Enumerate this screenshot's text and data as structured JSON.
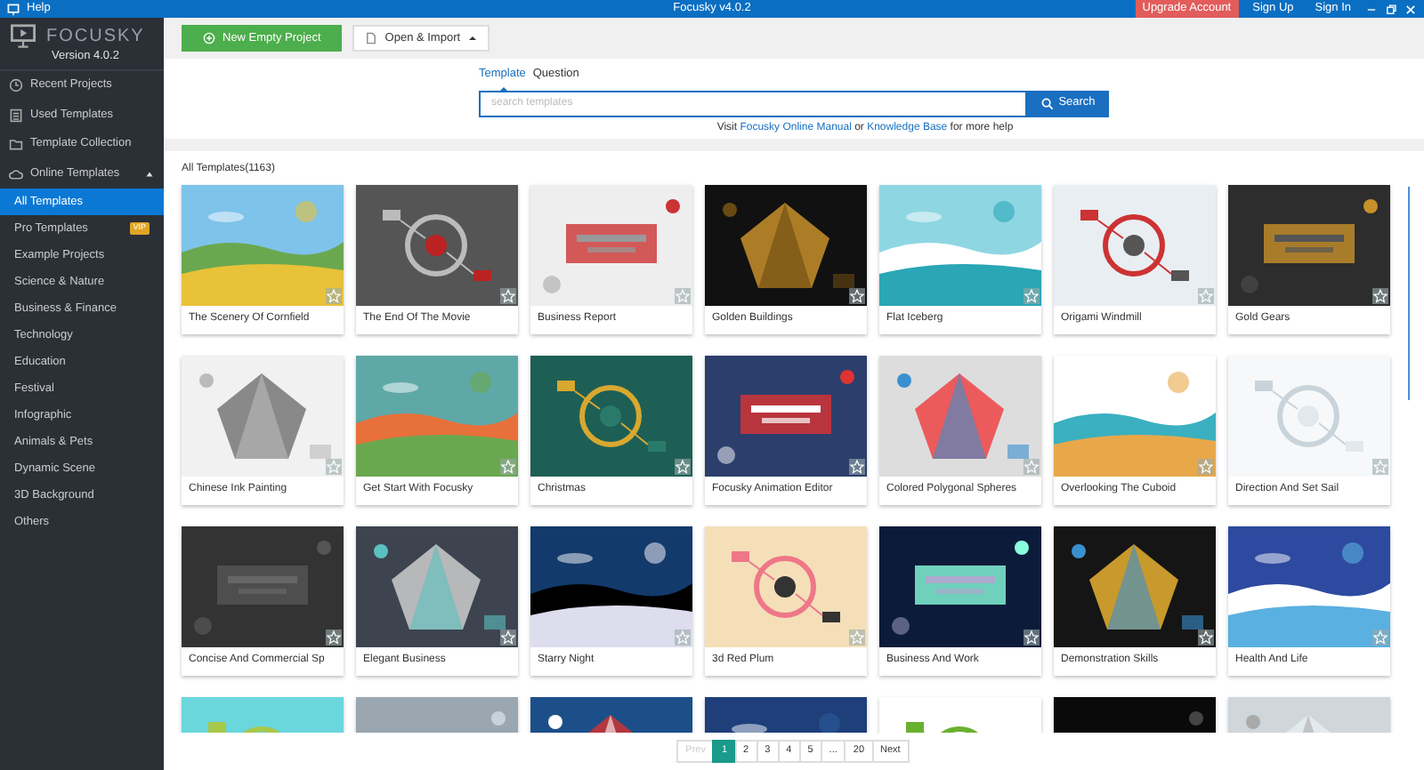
{
  "title_bar": {
    "menu": "Help",
    "title": "Focusky v4.0.2",
    "links": [
      {
        "label": "Upgrade Account",
        "kind": "highlight"
      },
      {
        "label": "Sign Up",
        "kind": "plain"
      },
      {
        "label": "Sign In",
        "kind": "plain"
      }
    ]
  },
  "sidebar": {
    "logo": "FOCUSKY",
    "version": "Version 4.0.2",
    "items": [
      {
        "label": "Recent Projects",
        "kind": "clock"
      },
      {
        "label": "Used Templates",
        "kind": "list"
      },
      {
        "label": "Template Collection",
        "kind": "folder"
      },
      {
        "label": "Online Templates",
        "kind": "cloud",
        "expanded": true,
        "children": [
          {
            "label": "All Templates",
            "selected": true
          },
          {
            "label": "Pro Templates",
            "selected": false,
            "badge": "VIP"
          },
          {
            "label": "Example Projects",
            "selected": false
          },
          {
            "label": "Science & Nature",
            "selected": false
          },
          {
            "label": "Business & Finance",
            "selected": false
          },
          {
            "label": "Technology",
            "selected": false
          },
          {
            "label": "Education",
            "selected": false
          },
          {
            "label": "Festival",
            "selected": false
          },
          {
            "label": "Infographic",
            "selected": false
          },
          {
            "label": "Animals & Pets",
            "selected": false
          },
          {
            "label": "Dynamic Scene",
            "selected": false
          },
          {
            "label": "3D Background",
            "selected": false
          },
          {
            "label": "Others",
            "selected": false
          }
        ]
      }
    ]
  },
  "toolbar": {
    "buttons": [
      {
        "label": "New Empty Project",
        "kind": "primary"
      },
      {
        "label": "Open & Import",
        "kind": "dropdown"
      }
    ]
  },
  "search": {
    "tabs": [
      {
        "label": "Template",
        "selected": true
      },
      {
        "label": "Question",
        "selected": false
      }
    ],
    "placeholder": "search templates",
    "button": "Search",
    "help": [
      {
        "text": "Visit ",
        "link": false
      },
      {
        "text": "Focusky Online Manual",
        "link": true
      },
      {
        "text": " or ",
        "link": false
      },
      {
        "text": "Knowledge Base",
        "link": true
      },
      {
        "text": " for more help",
        "link": false
      }
    ]
  },
  "content": {
    "heading": "All Templates(1163)",
    "templates": [
      {
        "kind": "template",
        "title": "The Scenery Of Cornfield"
      },
      {
        "kind": "template",
        "title": "The End Of The Movie"
      },
      {
        "kind": "template",
        "title": "Business Report"
      },
      {
        "kind": "template",
        "title": "Golden Buildings"
      },
      {
        "kind": "template",
        "title": "Flat Iceberg"
      },
      {
        "kind": "template",
        "title": "Origami Windmill"
      },
      {
        "kind": "template",
        "title": "Gold Gears"
      },
      {
        "kind": "template",
        "title": "Chinese Ink Painting"
      },
      {
        "kind": "template",
        "title": "Get Start With Focusky"
      },
      {
        "kind": "template",
        "title": "Christmas"
      },
      {
        "kind": "template",
        "title": "Focusky Animation Editor"
      },
      {
        "kind": "template",
        "title": "Colored Polygonal Spheres"
      },
      {
        "kind": "template",
        "title": "Overlooking The Cuboid"
      },
      {
        "kind": "template",
        "title": "Direction And Set Sail"
      },
      {
        "kind": "template",
        "title": "Concise And Commercial Sp"
      },
      {
        "kind": "template",
        "title": "Elegant Business"
      },
      {
        "kind": "template",
        "title": "Starry Night"
      },
      {
        "kind": "template",
        "title": "3d Red Plum"
      },
      {
        "kind": "template",
        "title": "Business And Work"
      },
      {
        "kind": "template",
        "title": "Demonstration Skills"
      },
      {
        "kind": "template",
        "title": "Health And Life"
      },
      {
        "kind": "picture"
      },
      {
        "kind": "picture"
      },
      {
        "kind": "picture"
      },
      {
        "kind": "picture"
      },
      {
        "kind": "picture"
      },
      {
        "kind": "picture"
      },
      {
        "kind": "picture"
      }
    ]
  },
  "pagination": [
    {
      "label": "Prev",
      "disabled": true,
      "selected": false
    },
    {
      "label": "1",
      "disabled": false,
      "selected": true
    },
    {
      "label": "2",
      "disabled": false,
      "selected": false
    },
    {
      "label": "3",
      "disabled": false,
      "selected": false
    },
    {
      "label": "4",
      "disabled": false,
      "selected": false
    },
    {
      "label": "5",
      "disabled": false,
      "selected": false
    },
    {
      "label": "...",
      "disabled": false,
      "selected": false
    },
    {
      "label": "20",
      "disabled": false,
      "selected": false
    },
    {
      "label": "Next",
      "disabled": false,
      "selected": false
    }
  ]
}
